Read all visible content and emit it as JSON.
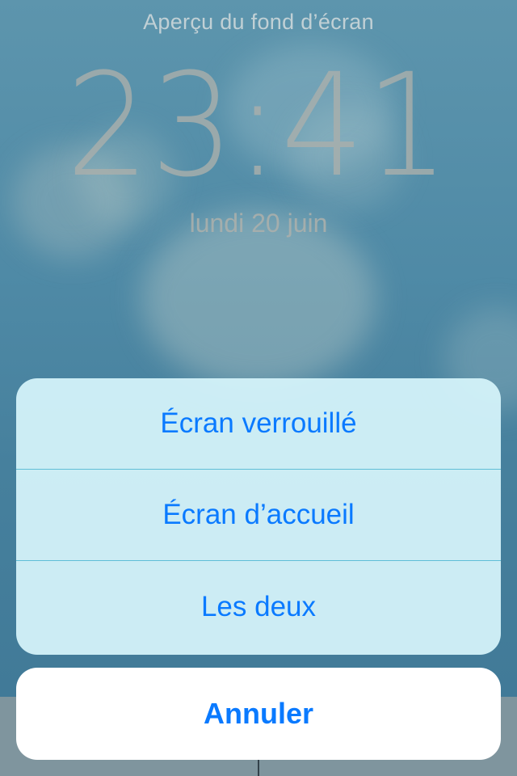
{
  "preview": {
    "title": "Aperçu du fond d’écran",
    "time": "23:41",
    "date": "lundi 20 juin"
  },
  "action_sheet": {
    "options": [
      {
        "label": "Écran verrouillé"
      },
      {
        "label": "Écran d’accueil"
      },
      {
        "label": "Les deux"
      }
    ],
    "cancel_label": "Annuler"
  },
  "colors": {
    "accent": "#0a7aff",
    "sheet_background": "#d5f3fa",
    "wallpaper": "#4f8aa6"
  }
}
